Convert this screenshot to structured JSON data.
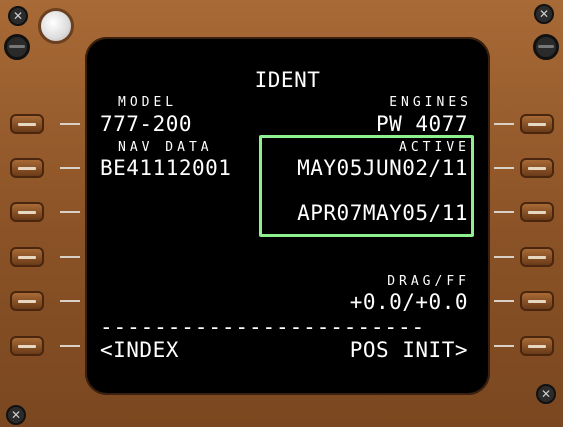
{
  "cdu": {
    "page_title": "IDENT",
    "model_label": "MODEL",
    "model_value": "777-200",
    "engines_label": "ENGINES",
    "engines_value": "PW 4077",
    "nav_data_label": "NAV DATA",
    "nav_data_value": "BE41112001",
    "active_label": "ACTIVE",
    "active_dates": "MAY05JUN02/11",
    "inactive_dates": "APR07MAY05/11",
    "drag_ff_label": "DRAG/FF",
    "drag_ff_value": "+0.0/+0.0",
    "separator": "------------------------",
    "left_6": "<INDEX",
    "right_6": "POS INIT>"
  },
  "colors": {
    "bezel": "#8a5226",
    "screen_text": "#ffffff",
    "highlight_box": "#8ef08e"
  },
  "icons": [
    "screw-icon",
    "line-select-key-icon",
    "brightness-knob-icon"
  ]
}
